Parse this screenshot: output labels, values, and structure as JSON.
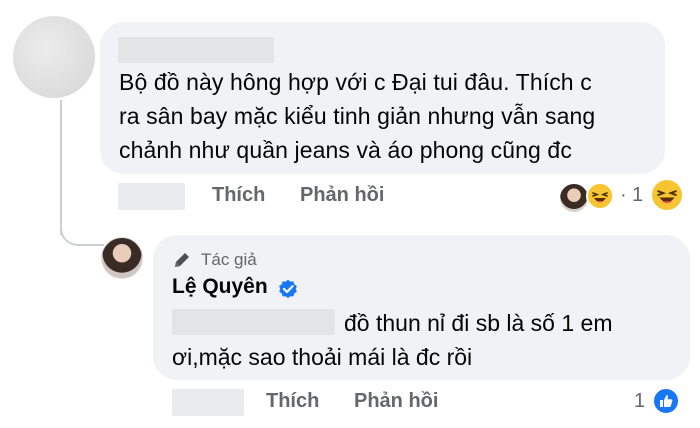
{
  "comment1": {
    "lines": [
      "Bộ đồ này hông hợp với c Đại tui đâu. Thích c",
      "ra sân bay mặc kiểu tinh giản nhưng vẫn sang",
      "chảnh như quần jeans và áo phong cũng đc"
    ],
    "actions": {
      "like": "Thích",
      "reply": "Phản hồi"
    },
    "reactions": {
      "separator": "·",
      "count": "1"
    }
  },
  "reply": {
    "badge_label": "Tác giả",
    "author": "Lệ Quyên",
    "text_line1": "đồ thun nỉ đi sb là số 1 em",
    "text_line2": "ơi,mặc sao thoải mái là đc rồi",
    "actions": {
      "like": "Thích",
      "reply": "Phản hồi"
    },
    "reactions": {
      "count": "1"
    }
  },
  "colors": {
    "bubble": "#f0f2f5",
    "meta_text": "#65676b",
    "verified": "#1877f2",
    "like": "#1877f2"
  },
  "icons": [
    "pencil-icon",
    "verified-badge-icon",
    "laughing-emoji-icon",
    "like-icon"
  ]
}
